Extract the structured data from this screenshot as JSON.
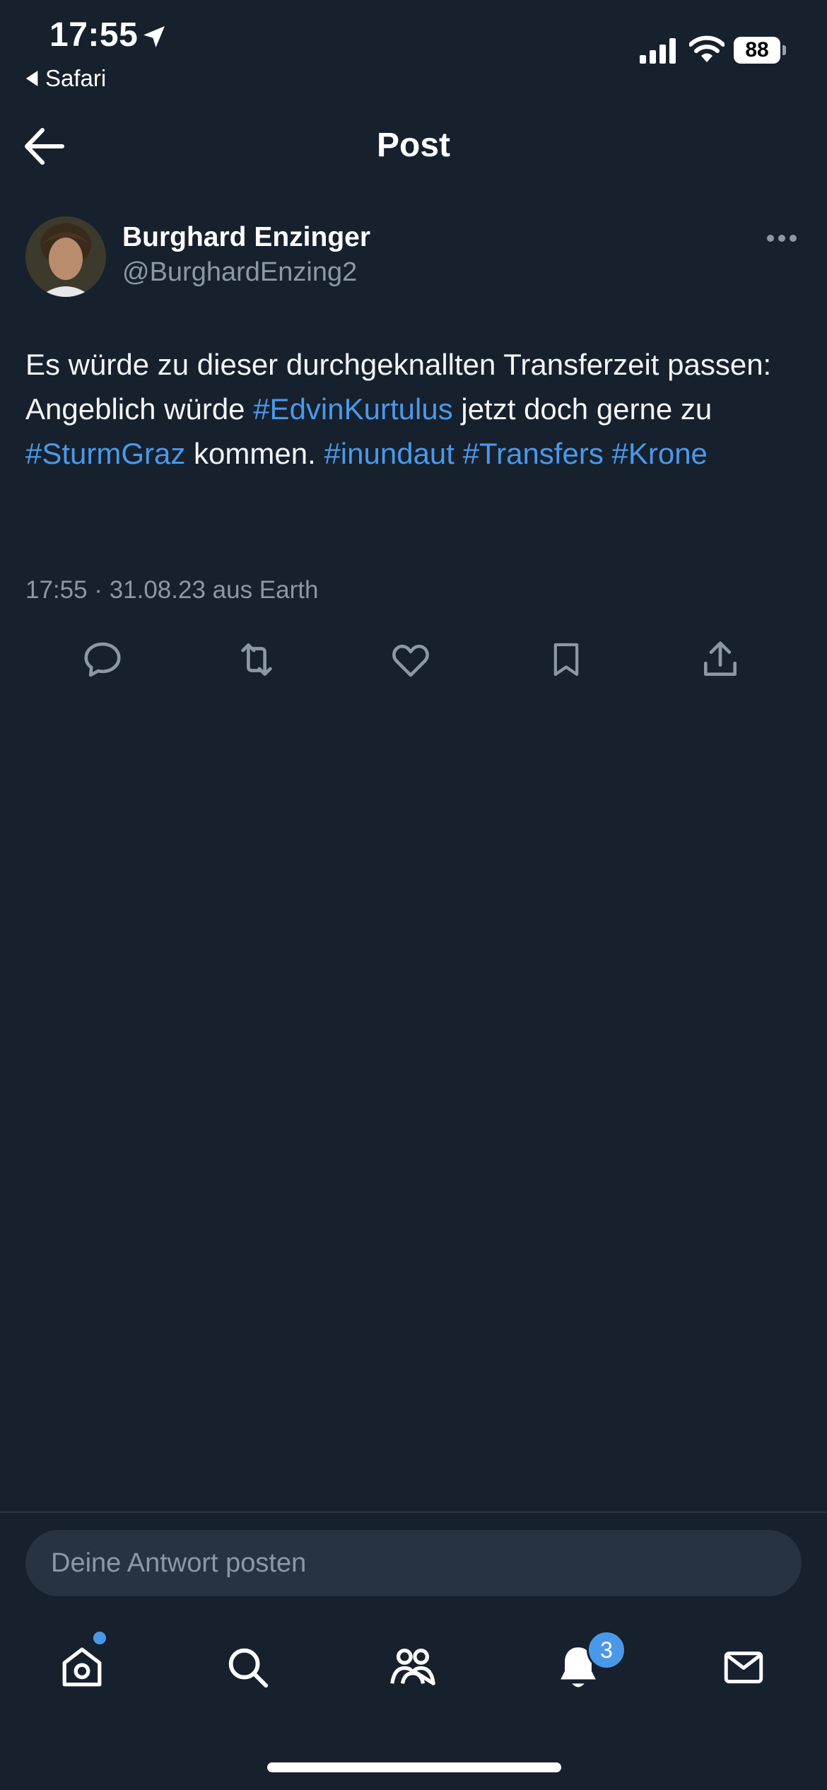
{
  "status_bar": {
    "time": "17:55",
    "back_app": "Safari",
    "battery": "88"
  },
  "header": {
    "title": "Post"
  },
  "post": {
    "author_name": "Burghard Enzinger",
    "author_handle": "@BurghardEnzing2",
    "text_segments": [
      {
        "text": "Es würde zu dieser durchgeknallten Transferzeit passen: Angeblich würde ",
        "hashtag": false
      },
      {
        "text": "#EdvinKurtulus",
        "hashtag": true
      },
      {
        "text": " jetzt doch gerne zu ",
        "hashtag": false
      },
      {
        "text": "#SturmGraz",
        "hashtag": true
      },
      {
        "text": " kommen. ",
        "hashtag": false
      },
      {
        "text": "#inundaut",
        "hashtag": true
      },
      {
        "text": " ",
        "hashtag": false
      },
      {
        "text": "#Transfers",
        "hashtag": true
      },
      {
        "text": " ",
        "hashtag": false
      },
      {
        "text": "#Krone",
        "hashtag": true
      }
    ],
    "meta": "17:55 · 31.08.23 aus Earth",
    "actions": [
      "reply-icon",
      "retweet-icon",
      "like-icon",
      "bookmark-icon",
      "share-icon"
    ]
  },
  "reply": {
    "placeholder": "Deine Antwort posten"
  },
  "tab_bar": {
    "items": [
      "home-icon",
      "search-icon",
      "communities-icon",
      "notifications-icon",
      "messages-icon"
    ],
    "notification_count": "3"
  },
  "colors": {
    "background": "#17202d",
    "accent": "#4a99e9",
    "secondary_text": "#8b98a5"
  }
}
